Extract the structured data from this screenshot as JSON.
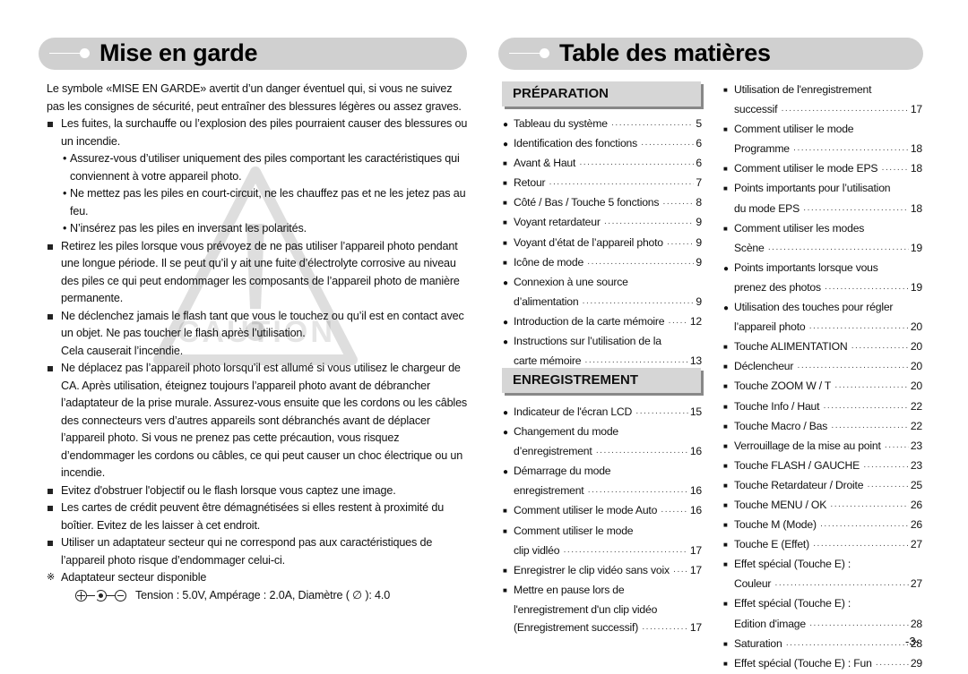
{
  "left": {
    "title": "Mise en garde",
    "intro": "Le symbole «MISE EN GARDE» avertit d’un danger éventuel qui, si vous ne suivez pas les consignes de sécurité, peut entraîner des blessures légères ou assez graves.",
    "items": [
      {
        "text": "Les fuites, la surchauffe ou l’explosion des piles pourraient causer des blessures ou un incendie.",
        "sub": [
          "Assurez-vous d’utiliser uniquement des piles comportant les caractéristiques qui conviennent à votre appareil photo.",
          "Ne mettez pas les piles en court-circuit, ne les chauffez pas et ne les jetez pas au feu.",
          "N’insérez pas les piles en inversant les polarités."
        ]
      },
      {
        "text": "Retirez les piles lorsque vous prévoyez de ne pas utiliser l’appareil photo pendant une longue période. Il se peut qu’il y ait une fuite d’électrolyte corrosive au niveau des piles ce qui peut endommager les composants de l’appareil photo de manière permanente."
      },
      {
        "text": "Ne déclenchez jamais le flash tant que vous le touchez ou qu’il est en contact avec un objet. Ne pas toucher le flash après l’utilisation.",
        "extra": "Cela causerait l’incendie."
      },
      {
        "text": "Ne déplacez pas l’appareil photo lorsqu’il est allumé si vous utilisez le chargeur de CA. Après utilisation, éteignez toujours l’appareil photo avant de débrancher l’adaptateur de la prise murale. Assurez-vous ensuite que les cordons ou les câbles des connecteurs vers d’autres appareils sont débranchés avant de déplacer l’appareil photo. Si vous ne prenez pas cette précaution, vous risquez d’endommager les cordons ou câbles, ce qui peut causer un choc électrique ou un incendie."
      },
      {
        "text": "Evitez d'obstruer l'objectif ou le flash lorsque vous captez une image."
      },
      {
        "text": "Les cartes de crédit peuvent être démagnétisées si elles restent à proximité du boîtier. Evitez de les laisser à cet endroit."
      },
      {
        "text": "Utiliser un adaptateur secteur qui ne correspond pas aux caractéristiques de l’appareil photo risque d’endommager celui-ci."
      }
    ],
    "note_symbol": "※",
    "note": "Adaptateur secteur disponible",
    "spec": "Tension : 5.0V, Ampérage : 2.0A, Diamètre ( ∅ ): 4.0",
    "watermark": "CAUTION"
  },
  "right": {
    "title": "Table des matières",
    "sections": [
      {
        "heading": "PRÉPARATION"
      },
      {
        "heading": "ENREGISTREMENT"
      }
    ],
    "col1": [
      {
        "m": "dot",
        "l": "Tableau du système",
        "p": "5"
      },
      {
        "m": "dot",
        "l": "Identification des fonctions",
        "p": "6"
      },
      {
        "m": "sq",
        "l": "Avant & Haut",
        "p": "6"
      },
      {
        "m": "sq",
        "l": "Retour",
        "p": "7"
      },
      {
        "m": "sq",
        "l": "Côté / Bas / Touche 5 fonctions",
        "p": "8"
      },
      {
        "m": "sq",
        "l": "Voyant retardateur",
        "p": "9"
      },
      {
        "m": "sq",
        "l": "Voyant d’état de l’appareil photo",
        "p": "9"
      },
      {
        "m": "sq",
        "l": "Icône de mode",
        "p": "9"
      },
      {
        "m": "dot",
        "l": "Connexion à une source",
        "p": ""
      },
      {
        "m": "none",
        "l": "d’alimentation",
        "p": "9"
      },
      {
        "m": "dot",
        "l": "Introduction de la carte mémoire",
        "p": "12"
      },
      {
        "m": "dot",
        "l": "Instructions sur l’utilisation de la",
        "p": ""
      },
      {
        "m": "none",
        "l": "carte mémoire",
        "p": "13"
      }
    ],
    "col2": [
      {
        "m": "dot",
        "l": "Indicateur de l'écran LCD",
        "p": "15"
      },
      {
        "m": "dot",
        "l": "Changement du mode",
        "p": ""
      },
      {
        "m": "none",
        "l": "d’enregistrement",
        "p": "16"
      },
      {
        "m": "dot",
        "l": "Démarrage du mode",
        "p": ""
      },
      {
        "m": "none",
        "l": "enregistrement",
        "p": "16"
      },
      {
        "m": "sq",
        "l": "Comment utiliser le mode Auto",
        "p": "16"
      },
      {
        "m": "sq",
        "l": "Comment utiliser le mode",
        "p": ""
      },
      {
        "m": "none",
        "l": "clip vidléo",
        "p": "17"
      },
      {
        "m": "sq",
        "l": "Enregistrer le clip vidéo sans voix",
        "p": "17"
      },
      {
        "m": "sq",
        "l": "Mettre en pause lors de",
        "p": ""
      },
      {
        "m": "none",
        "l": "l'enregistrement d'un clip vidéo",
        "p": ""
      },
      {
        "m": "none",
        "l": "(Enregistrement successif)",
        "p": "17"
      }
    ],
    "col3": [
      {
        "m": "sq",
        "l": "Utilisation de l'enregistrement",
        "p": ""
      },
      {
        "m": "none",
        "l": "successif",
        "p": "17"
      },
      {
        "m": "sq",
        "l": "Comment utiliser le mode",
        "p": ""
      },
      {
        "m": "none",
        "l": "Programme",
        "p": "18"
      },
      {
        "m": "sq",
        "l": "Comment utiliser le mode EPS",
        "p": "18"
      },
      {
        "m": "sq",
        "l": "Points importants pour l’utilisation",
        "p": ""
      },
      {
        "m": "none",
        "l": "du mode EPS",
        "p": "18"
      },
      {
        "m": "sq",
        "l": "Comment utiliser les modes",
        "p": ""
      },
      {
        "m": "none",
        "l": "Scène",
        "p": "19"
      },
      {
        "m": "dot",
        "l": "Points importants lorsque vous",
        "p": ""
      },
      {
        "m": "none",
        "l": "prenez des photos",
        "p": "19"
      },
      {
        "m": "dot",
        "l": "Utilisation des touches pour régler",
        "p": ""
      },
      {
        "m": "none",
        "l": "l’appareil photo",
        "p": "20"
      },
      {
        "m": "sq",
        "l": "Touche ALIMENTATION",
        "p": "20"
      },
      {
        "m": "sq",
        "l": "Déclencheur",
        "p": "20"
      },
      {
        "m": "sq",
        "l": "Touche ZOOM W / T",
        "p": "20"
      },
      {
        "m": "sq",
        "l": "Touche Info / Haut",
        "p": "22"
      },
      {
        "m": "sq",
        "l": "Touche Macro / Bas",
        "p": "22"
      },
      {
        "m": "sq",
        "l": "Verrouillage de la mise au point",
        "p": "23"
      },
      {
        "m": "sq",
        "l": "Touche FLASH / GAUCHE",
        "p": "23"
      },
      {
        "m": "sq",
        "l": "Touche Retardateur / Droite",
        "p": "25"
      },
      {
        "m": "sq",
        "l": "Touche MENU / OK",
        "p": "26"
      },
      {
        "m": "sq",
        "l": "Touche M (Mode)",
        "p": "26"
      },
      {
        "m": "sq",
        "l": "Touche E (Effet)",
        "p": "27"
      },
      {
        "m": "sq",
        "l": "Effet spécial (Touche E) :",
        "p": ""
      },
      {
        "m": "none",
        "l": "Couleur",
        "p": "27"
      },
      {
        "m": "sq",
        "l": "Effet spécial (Touche E) :",
        "p": ""
      },
      {
        "m": "none",
        "l": "Edition d'image",
        "p": "28"
      },
      {
        "m": "sq",
        "l": "Saturation",
        "p": "28"
      },
      {
        "m": "sq",
        "l": "Effet spécial (Touche E) : Fun",
        "p": "29"
      }
    ]
  },
  "page_number": "-3-"
}
